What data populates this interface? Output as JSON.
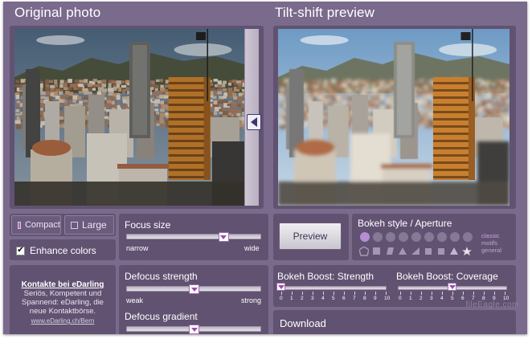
{
  "titles": {
    "original": "Original photo",
    "preview": "Tilt-shift preview"
  },
  "view_toggle": {
    "compact": "Compact",
    "large": "Large",
    "active": "compact"
  },
  "enhance": {
    "label": "Enhance colors",
    "checked": true,
    "mark": "✔"
  },
  "focus_size": {
    "label": "Focus size",
    "min_label": "narrow",
    "max_label": "wide",
    "value": 0.72
  },
  "defocus_strength": {
    "label": "Defocus strength",
    "min_label": "weak",
    "max_label": "strong",
    "value": 0.5
  },
  "defocus_gradient": {
    "label": "Defocus gradient",
    "value": 0.5
  },
  "preview_button": "Preview",
  "bokeh": {
    "title": "Bokeh style / Aperture",
    "options": [
      "classic",
      "motifs",
      "general"
    ],
    "selected_index": 0
  },
  "bokeh_boost_strength": {
    "label": "Bokeh Boost: Strength",
    "ticks": [
      "0",
      "1",
      "2",
      "3",
      "4",
      "5",
      "6",
      "7",
      "8",
      "9",
      "10"
    ],
    "value": 0
  },
  "bokeh_boost_coverage": {
    "label": "Bokeh Boost: Coverage",
    "ticks": [
      "0",
      "1",
      "2",
      "3",
      "4",
      "5",
      "6",
      "7",
      "8",
      "9",
      "10"
    ],
    "value": 5
  },
  "download": {
    "label": "Download"
  },
  "ad": {
    "title": "Kontakte bei eDarling",
    "text": "Seriös, Kompetent und Spannend: eDarling, die neue Kontaktbörse.",
    "link": "www.eDarling.ch/Bern"
  },
  "watermark": "fileEagle.com",
  "icons": {
    "arrow": "arrow-left-icon",
    "check": "checkmark-icon"
  },
  "colors": {
    "background": "#7a6a8c",
    "panel": "#615272",
    "accent": "#b48ed0"
  }
}
